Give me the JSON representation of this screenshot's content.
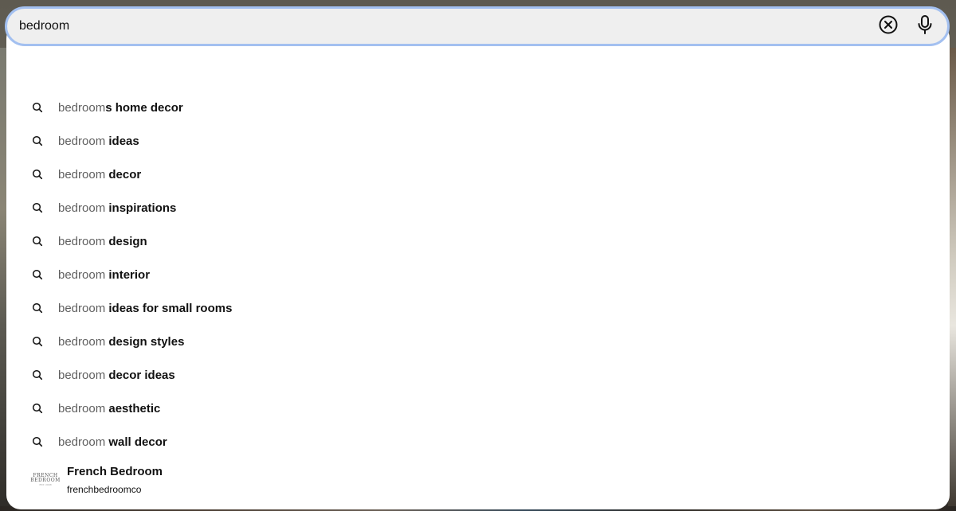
{
  "search": {
    "value": "bedroom",
    "clear_icon": "circle-x-icon",
    "mic_icon": "microphone-icon"
  },
  "suggestions": [
    {
      "typed": "bedroom",
      "rest": "s home decor"
    },
    {
      "typed": "bedroom",
      "rest": " ideas"
    },
    {
      "typed": "bedroom",
      "rest": " decor"
    },
    {
      "typed": "bedroom",
      "rest": " inspirations"
    },
    {
      "typed": "bedroom",
      "rest": " design"
    },
    {
      "typed": "bedroom",
      "rest": " interior"
    },
    {
      "typed": "bedroom",
      "rest": " ideas for small rooms"
    },
    {
      "typed": "bedroom",
      "rest": " design styles"
    },
    {
      "typed": "bedroom",
      "rest": " decor ideas"
    },
    {
      "typed": "bedroom",
      "rest": " aesthetic"
    },
    {
      "typed": "bedroom",
      "rest": " wall decor"
    }
  ],
  "profile": {
    "name": "French Bedroom",
    "handle": "frenchbedroomco",
    "avatar_line1": "FRENCH",
    "avatar_line2": "BEDROOM",
    "avatar_line3": "EST. 2008"
  },
  "colors": {
    "focus_ring": "#a3c0f0",
    "input_bg": "#efefef",
    "typed_text": "#5f5f5f",
    "completion_text": "#111111"
  }
}
